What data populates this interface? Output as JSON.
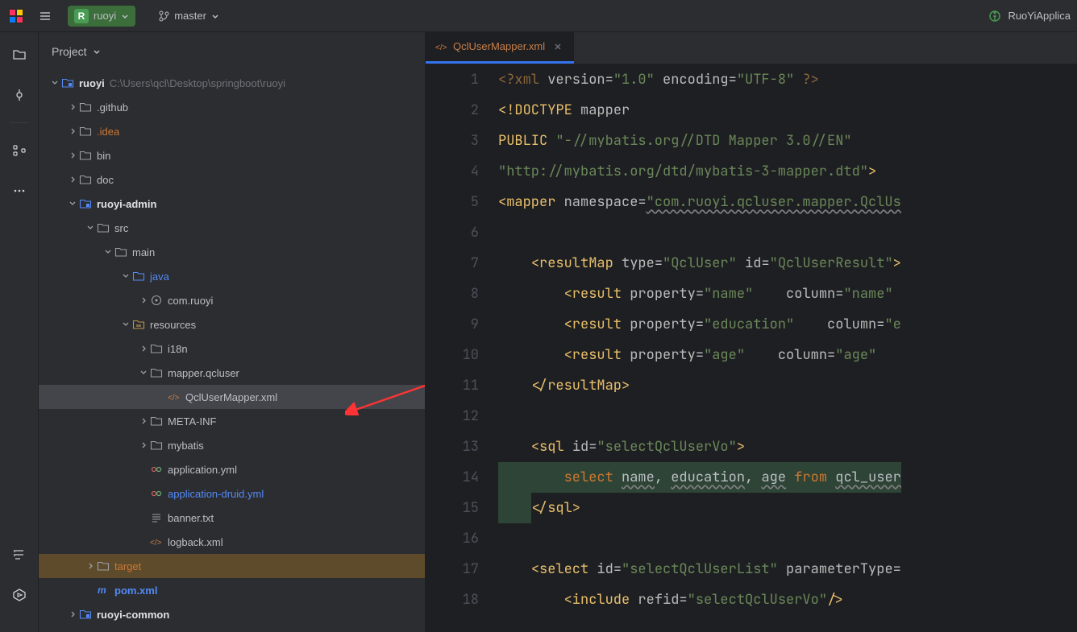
{
  "topbar": {
    "project_letter": "R",
    "project_name": "ruoyi",
    "branch": "master",
    "run_config": "RuoYiApplica"
  },
  "project_panel": {
    "title": "Project"
  },
  "tree": {
    "root_name": "ruoyi",
    "root_path": "C:\\Users\\qcl\\Desktop\\springboot\\ruoyi",
    "items": [
      {
        "label": ".github",
        "indent": 1,
        "chev": "collapsed",
        "icon": "folder"
      },
      {
        "label": ".idea",
        "indent": 1,
        "chev": "collapsed",
        "icon": "folder",
        "color": "orange"
      },
      {
        "label": "bin",
        "indent": 1,
        "chev": "collapsed",
        "icon": "folder"
      },
      {
        "label": "doc",
        "indent": 1,
        "chev": "collapsed",
        "icon": "folder"
      },
      {
        "label": "ruoyi-admin",
        "indent": 1,
        "chev": "expanded",
        "icon": "module",
        "bold": true
      },
      {
        "label": "src",
        "indent": 2,
        "chev": "expanded",
        "icon": "folder"
      },
      {
        "label": "main",
        "indent": 3,
        "chev": "expanded",
        "icon": "folder"
      },
      {
        "label": "java",
        "indent": 4,
        "chev": "expanded",
        "icon": "source-folder",
        "color": "blue"
      },
      {
        "label": "com.ruoyi",
        "indent": 5,
        "chev": "collapsed",
        "icon": "package"
      },
      {
        "label": "resources",
        "indent": 4,
        "chev": "expanded",
        "icon": "resource-folder"
      },
      {
        "label": "i18n",
        "indent": 5,
        "chev": "collapsed",
        "icon": "folder"
      },
      {
        "label": "mapper.qcluser",
        "indent": 5,
        "chev": "expanded",
        "icon": "folder",
        "arrow": true
      },
      {
        "label": "QclUserMapper.xml",
        "indent": 6,
        "chev": "none",
        "icon": "xml",
        "selected": true
      },
      {
        "label": "META-INF",
        "indent": 5,
        "chev": "collapsed",
        "icon": "folder"
      },
      {
        "label": "mybatis",
        "indent": 5,
        "chev": "collapsed",
        "icon": "folder"
      },
      {
        "label": "application.yml",
        "indent": 5,
        "chev": "none",
        "icon": "yml"
      },
      {
        "label": "application-druid.yml",
        "indent": 5,
        "chev": "none",
        "icon": "yml",
        "color": "blue"
      },
      {
        "label": "banner.txt",
        "indent": 5,
        "chev": "none",
        "icon": "txt"
      },
      {
        "label": "logback.xml",
        "indent": 5,
        "chev": "none",
        "icon": "xml"
      },
      {
        "label": "target",
        "indent": 2,
        "chev": "collapsed",
        "icon": "folder",
        "color": "orange",
        "target": true
      },
      {
        "label": "pom.xml",
        "indent": 2,
        "chev": "none",
        "icon": "maven",
        "bold": true,
        "color": "blue"
      },
      {
        "label": "ruoyi-common",
        "indent": 1,
        "chev": "collapsed",
        "icon": "module",
        "bold": true
      }
    ]
  },
  "editor": {
    "tab_label": "QclUserMapper.xml",
    "lines": [
      {
        "n": 1,
        "html": "<span class='tok-pi'>&lt;?xml</span> <span class='tok-attr'>version</span>=<span class='tok-str'>\"1.0\"</span> <span class='tok-attr'>encoding</span>=<span class='tok-str'>\"UTF-8\"</span> <span class='tok-pi'>?&gt;</span>"
      },
      {
        "n": 2,
        "html": "<span class='tok-doctype'>&lt;!DOCTYPE</span> <span class='tok-attr'>mapper</span>"
      },
      {
        "n": 3,
        "html": "<span class='tok-doctype'>PUBLIC</span> <span class='tok-str'>\"-//mybatis.org//DTD Mapper 3.0//EN\"</span>"
      },
      {
        "n": 4,
        "html": "<span class='tok-str'>\"http://mybatis.org/dtd/mybatis-3-mapper.dtd\"</span><span class='tok-doctype'>&gt;</span>"
      },
      {
        "n": 5,
        "html": "<span class='tok-tag'>&lt;mapper</span> <span class='tok-attr'>namespace</span>=<span class='tok-str warn-underline'>\"com.ruoyi.qcluser.mapper.QclUs</span>"
      },
      {
        "n": 6,
        "html": ""
      },
      {
        "n": 7,
        "html": "    <span class='tok-tag'>&lt;resultMap</span> <span class='tok-attr'>type</span>=<span class='tok-str'>\"QclUser\"</span> <span class='tok-attr'>id</span>=<span class='tok-str'>\"QclUserResult\"</span><span class='tok-tag'>&gt;</span>"
      },
      {
        "n": 8,
        "html": "        <span class='tok-tag'>&lt;result</span> <span class='tok-attr'>property</span>=<span class='tok-str'>\"name\"</span>    <span class='tok-attr'>column</span>=<span class='tok-str'>\"name\"</span>"
      },
      {
        "n": 9,
        "html": "        <span class='tok-tag'>&lt;result</span> <span class='tok-attr'>property</span>=<span class='tok-str'>\"education\"</span>    <span class='tok-attr'>column</span>=<span class='tok-str'>\"e</span>"
      },
      {
        "n": 10,
        "html": "        <span class='tok-tag'>&lt;result</span> <span class='tok-attr'>property</span>=<span class='tok-str'>\"age\"</span>    <span class='tok-attr'>column</span>=<span class='tok-str'>\"age\"</span>"
      },
      {
        "n": 11,
        "html": "    <span class='tok-tag'>&lt;/resultMap&gt;</span>"
      },
      {
        "n": 12,
        "html": ""
      },
      {
        "n": 13,
        "html": "    <span class='tok-tag'>&lt;sql</span> <span class='tok-attr'>id</span>=<span class='tok-str'>\"selectQclUserVo\"</span><span class='tok-tag'>&gt;</span>",
        "sqlStart": true
      },
      {
        "n": 14,
        "html": "<span class='sql-bg'>        <span class='tok-kw'>select</span> <span class='warn-underline'>name</span>, <span class='warn-underline'>education</span>, <span class='warn-underline'>age</span> <span class='tok-kw'>from</span> <span class='warn-underline'>qcl_user</span></span>"
      },
      {
        "n": 15,
        "html": "<span class='sql-bg'>    </span><span class='tok-tag'>&lt;/sql&gt;</span>"
      },
      {
        "n": 16,
        "html": ""
      },
      {
        "n": 17,
        "html": "    <span class='tok-tag'>&lt;select</span> <span class='tok-attr'>id</span>=<span class='tok-str'>\"selectQclUserList\"</span> <span class='tok-attr'>parameterType</span>="
      },
      {
        "n": 18,
        "html": "        <span class='tok-tag'>&lt;include</span> <span class='tok-attr'>refid</span>=<span class='tok-str'>\"selectQclUserVo\"</span><span class='tok-tag'>/&gt;</span>"
      }
    ]
  }
}
